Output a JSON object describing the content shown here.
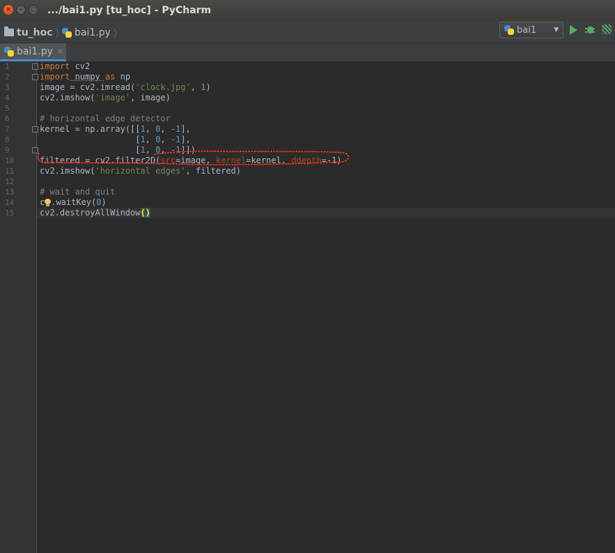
{
  "window": {
    "title": ".../bai1.py [tu_hoc] - PyCharm",
    "close_glyph": "×",
    "min_glyph": "–",
    "max_glyph": "□"
  },
  "navbar": {
    "project": "tu_hoc",
    "file": "bai1.py",
    "run_config": "bai1",
    "separator": "〉"
  },
  "tabs": [
    {
      "label": "bai1.py",
      "close_glyph": "×"
    }
  ],
  "editor": {
    "line_numbers": [
      "1",
      "2",
      "3",
      "4",
      "5",
      "6",
      "7",
      "8",
      "9",
      "10",
      "11",
      "12",
      "13",
      "14",
      "15"
    ],
    "colors": {
      "background": "#2b2b2b",
      "keyword": "#cc7832",
      "number": "#6897bb",
      "string": "#6a8759",
      "comment": "#808080",
      "parameter": "#aa4926",
      "default": "#a9b7c6",
      "annotation": "#e01212"
    },
    "code": {
      "l1_kw": "import",
      "l1_rest": " cv2",
      "l2_kw": "import",
      "l2_mid": " numpy ",
      "l2_kw2": "as",
      "l2_rest": " np",
      "l3_a": "image = cv2.imread(",
      "l3_str": "'clock.jpg'",
      "l3_b": ", ",
      "l3_num": "1",
      "l3_c": ")",
      "l4_a": "cv2.imshow(",
      "l4_str": "'image'",
      "l4_b": ", image)",
      "l6": "# horizontal edge detector",
      "l7_a": "kernel = np.array([[",
      "l7_n1": "1",
      "l7_s1": ", ",
      "l7_n2": "0",
      "l7_s2": ", ",
      "l7_n3": "-1",
      "l7_b": "],",
      "l8_a": "                   [",
      "l8_n1": "1",
      "l8_s1": ", ",
      "l8_n2": "0",
      "l8_s2": ", ",
      "l8_n3": "-1",
      "l8_b": "],",
      "l9_a": "                   [",
      "l9_n1": "1",
      "l9_s1": ", ",
      "l9_n2": "0",
      "l9_s2": ", ",
      "l9_n3": "-1",
      "l9_b": "]])",
      "l10_a": "filtered = cv2.filter2D(",
      "l10_p1": "src",
      "l10_b": "=image, ",
      "l10_p2": "kernel",
      "l10_c": "=kernel, ",
      "l10_p3": "ddepth",
      "l10_d": "=-1)",
      "l11_a": "cv2.imshow(",
      "l11_str": "'horizontal edges'",
      "l11_b": ", filtered)",
      "l13": "# wait and quit",
      "l14_a": "c",
      "l14_b": ".waitKey(",
      "l14_num": "0",
      "l14_c": ")",
      "l15_a": "cv2.destroyAllWindow",
      "l15_paren": "()"
    }
  }
}
